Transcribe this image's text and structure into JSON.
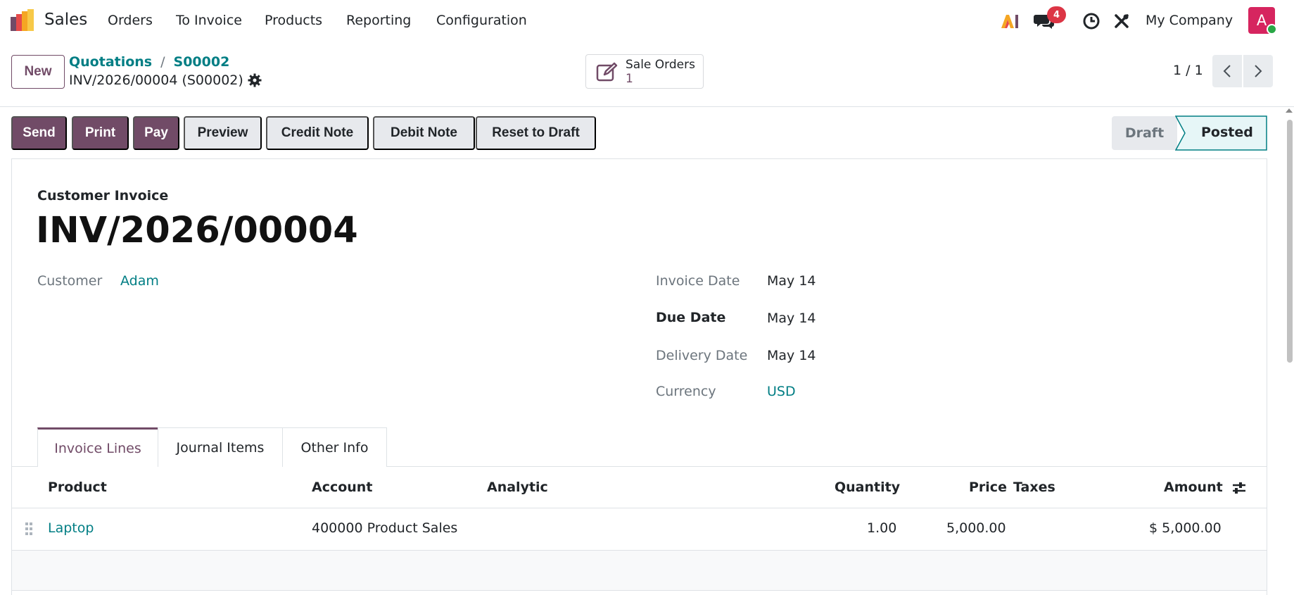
{
  "navbar": {
    "app_name": "Sales",
    "menus": [
      "Orders",
      "To Invoice",
      "Products",
      "Reporting",
      "Configuration"
    ],
    "message_count": "4",
    "company": "My Company",
    "avatar_letter": "A",
    "icons": [
      "ai-icon",
      "messages-icon",
      "clock-icon",
      "tools-icon"
    ]
  },
  "control": {
    "new_label": "New",
    "breadcrumbs": [
      "Quotations",
      "S00002"
    ],
    "breadcrumb_sep": "/",
    "record_name": "INV/2026/00004 (S00002)",
    "smart_button": {
      "label": "Sale Orders",
      "count": "1"
    },
    "pager": "1 / 1"
  },
  "actions": {
    "send": "Send",
    "print": "Print",
    "pay": "Pay",
    "preview": "Preview",
    "credit_note": "Credit Note",
    "debit_note": "Debit Note",
    "reset_to_draft": "Reset to Draft"
  },
  "status": {
    "draft": "Draft",
    "posted": "Posted",
    "current": "Posted"
  },
  "invoice": {
    "type": "Customer Invoice",
    "number": "INV/2026/00004",
    "customer_label": "Customer",
    "customer": "Adam",
    "invoice_date_label": "Invoice Date",
    "invoice_date": "May 14",
    "due_date_label": "Due Date",
    "due_date": "May 14",
    "delivery_date_label": "Delivery Date",
    "delivery_date": "May 14",
    "currency_label": "Currency",
    "currency": "USD"
  },
  "tabs": [
    "Invoice Lines",
    "Journal Items",
    "Other Info"
  ],
  "table": {
    "headers": {
      "product": "Product",
      "account": "Account",
      "analytic": "Analytic",
      "quantity": "Quantity",
      "price": "Price",
      "taxes": "Taxes",
      "amount": "Amount"
    },
    "rows": [
      {
        "product": "Laptop",
        "account": "400000 Product Sales",
        "analytic": "",
        "quantity": "1.00",
        "price": "5,000.00",
        "taxes": "",
        "amount": "$ 5,000.00"
      }
    ]
  },
  "colors": {
    "primary": "#714b67",
    "link": "#017e84",
    "avatar": "#d6255f",
    "badge": "#dc3545"
  }
}
